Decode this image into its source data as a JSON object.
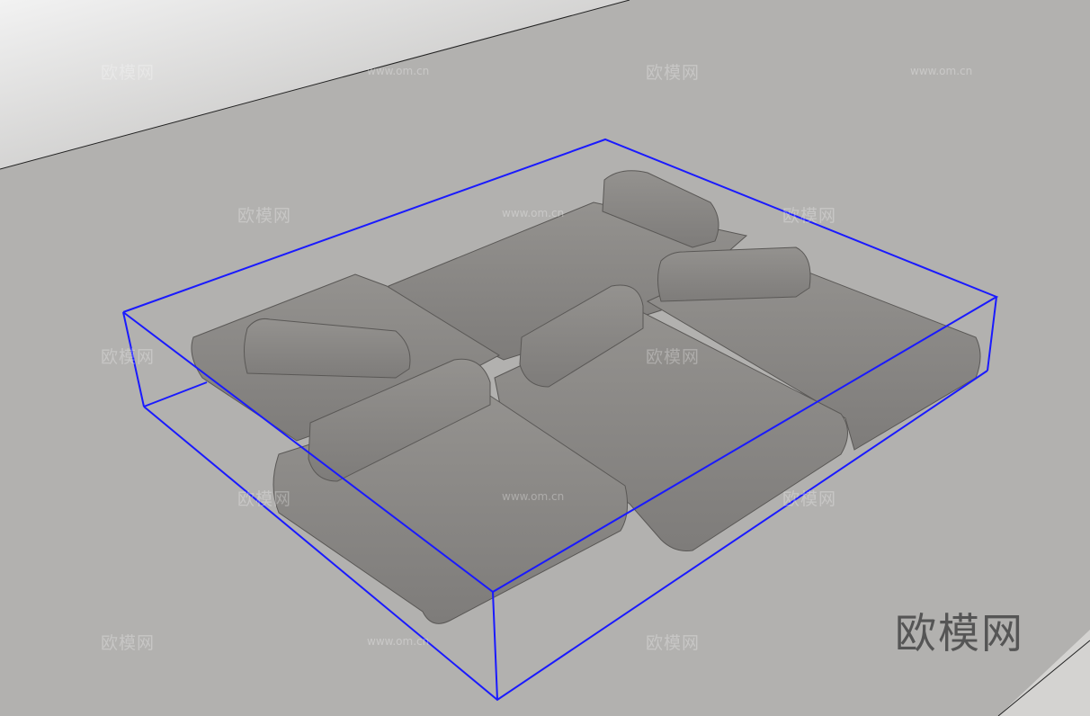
{
  "watermark": {
    "brand": "欧模网",
    "url": "www.om.cn"
  },
  "logo": {
    "text": "欧模网"
  },
  "colors": {
    "floor": "#b2b1af",
    "cushion": "#8b8987",
    "selection_box": "#1a1aff"
  }
}
